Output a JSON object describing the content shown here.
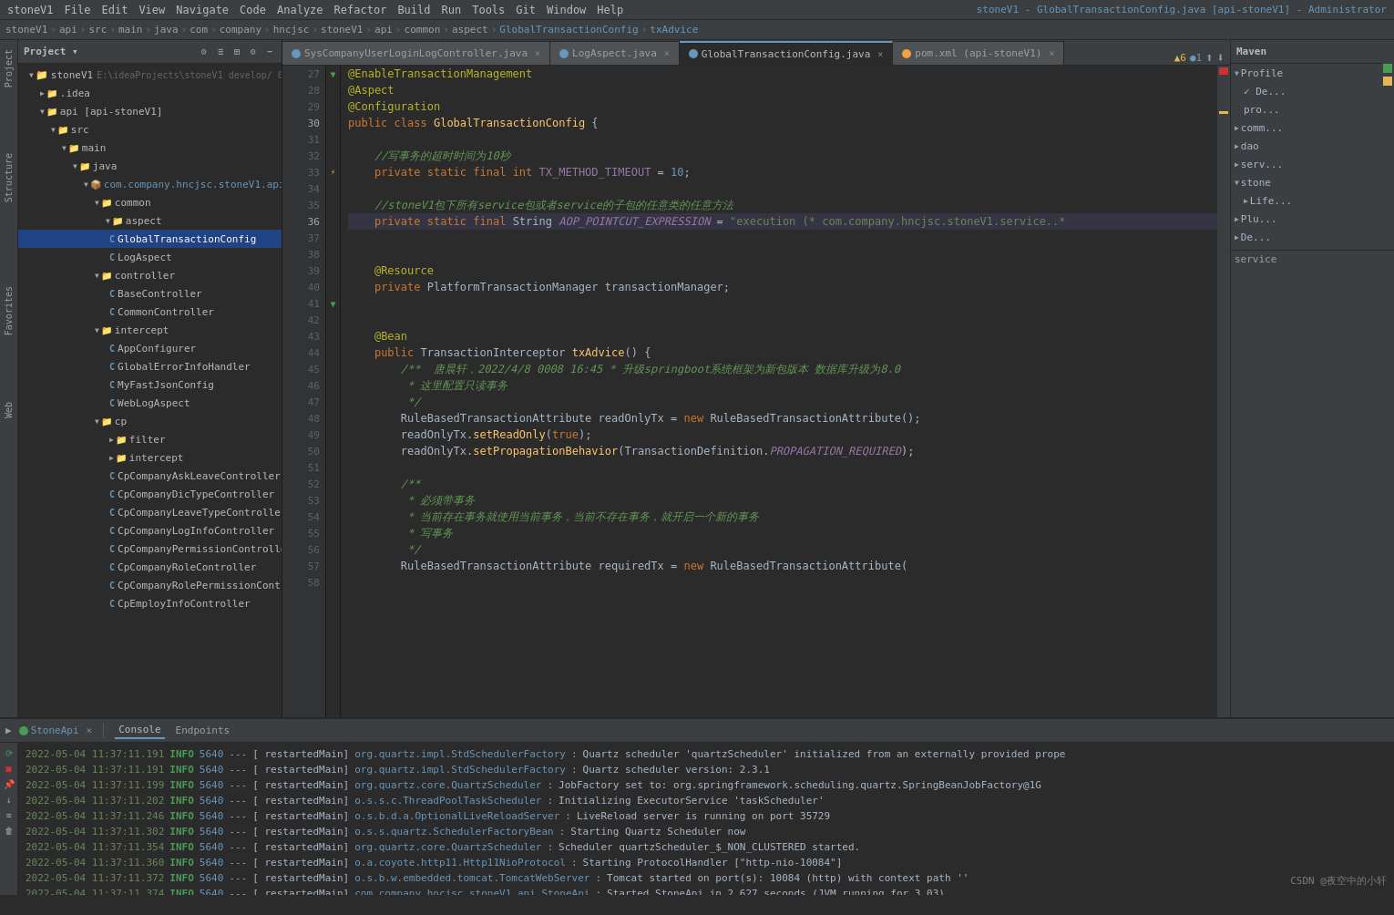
{
  "app": {
    "title": "stoneV1 - GlobalTransactionConfig.java [api-stoneV1] - Administrator"
  },
  "menubar": {
    "items": [
      "stoneV1",
      "File",
      "Edit",
      "View",
      "Navigate",
      "Code",
      "Analyze",
      "Refactor",
      "Build",
      "Run",
      "Tools",
      "Git",
      "Window",
      "Help"
    ]
  },
  "breadcrumb": {
    "items": [
      "stoneV1",
      "api",
      "src",
      "main",
      "java",
      "com",
      "company",
      "hncjsc",
      "stoneV1",
      "api",
      "common",
      "aspect",
      "GlobalTransactionConfig",
      "txAdvice"
    ]
  },
  "project_panel": {
    "header": "Project",
    "tree": [
      {
        "label": "stoneV1",
        "indent": 0,
        "type": "project",
        "expanded": true,
        "path": "E:\\ideaProjects\\stoneV1 develop/ 0"
      },
      {
        "label": ".idea",
        "indent": 1,
        "type": "folder",
        "expanded": false
      },
      {
        "label": "api [api-stoneV1]",
        "indent": 1,
        "type": "module",
        "expanded": true
      },
      {
        "label": "src",
        "indent": 2,
        "type": "folder",
        "expanded": true
      },
      {
        "label": "main",
        "indent": 3,
        "type": "folder",
        "expanded": true
      },
      {
        "label": "java",
        "indent": 4,
        "type": "folder",
        "expanded": true
      },
      {
        "label": "com.company.hncjsc.stoneV1.api",
        "indent": 5,
        "type": "package",
        "expanded": true
      },
      {
        "label": "common",
        "indent": 6,
        "type": "folder",
        "expanded": true
      },
      {
        "label": "aspect",
        "indent": 7,
        "type": "folder",
        "expanded": true
      },
      {
        "label": "GlobalTransactionConfig",
        "indent": 8,
        "type": "java",
        "selected": true
      },
      {
        "label": "LogAspect",
        "indent": 8,
        "type": "java"
      },
      {
        "label": "controller",
        "indent": 7,
        "type": "folder",
        "expanded": true
      },
      {
        "label": "BaseController",
        "indent": 8,
        "type": "java"
      },
      {
        "label": "CommonController",
        "indent": 8,
        "type": "java"
      },
      {
        "label": "intercept",
        "indent": 7,
        "type": "folder",
        "expanded": true
      },
      {
        "label": "AppConfigurer",
        "indent": 8,
        "type": "java"
      },
      {
        "label": "GlobalErrorInfoHandler",
        "indent": 8,
        "type": "java"
      },
      {
        "label": "MyFastJsonConfig",
        "indent": 8,
        "type": "java"
      },
      {
        "label": "WebLogAspect",
        "indent": 8,
        "type": "java"
      },
      {
        "label": "cp",
        "indent": 7,
        "type": "folder",
        "expanded": true
      },
      {
        "label": "filter",
        "indent": 8,
        "type": "folder"
      },
      {
        "label": "intercept",
        "indent": 8,
        "type": "folder"
      },
      {
        "label": "CpCompanyAskLeaveController",
        "indent": 8,
        "type": "java"
      },
      {
        "label": "CpCompanyDicTypeController",
        "indent": 8,
        "type": "java"
      },
      {
        "label": "CpCompanyLeaveTypeController",
        "indent": 8,
        "type": "java"
      },
      {
        "label": "CpCompanyLogInfoController",
        "indent": 8,
        "type": "java"
      },
      {
        "label": "CpCompanyPermissionController",
        "indent": 8,
        "type": "java"
      },
      {
        "label": "CpCompanyRoleController",
        "indent": 8,
        "type": "java"
      },
      {
        "label": "CpCompanyRolePermissionController",
        "indent": 8,
        "type": "java"
      },
      {
        "label": "CpEmployInfoController",
        "indent": 8,
        "type": "java"
      }
    ]
  },
  "tabs": [
    {
      "label": "SysCompanyUserLoginLogController.java",
      "type": "java",
      "active": false
    },
    {
      "label": "LogAspect.java",
      "type": "java",
      "active": false
    },
    {
      "label": "GlobalTransactionConfig.java",
      "type": "java",
      "active": true
    },
    {
      "label": "pom.xml (api-stoneV1)",
      "type": "xml",
      "active": false
    }
  ],
  "code": {
    "lines": [
      {
        "num": 27,
        "content": "@EnableTransactionManagement"
      },
      {
        "num": 28,
        "content": "@Aspect"
      },
      {
        "num": 29,
        "content": "@Configuration"
      },
      {
        "num": 30,
        "content": "public class GlobalTransactionConfig {"
      },
      {
        "num": 31,
        "content": ""
      },
      {
        "num": 32,
        "content": "    //写事务的超时时间为10秒"
      },
      {
        "num": 33,
        "content": "    private static final int TX_METHOD_TIMEOUT = 10;"
      },
      {
        "num": 34,
        "content": ""
      },
      {
        "num": 35,
        "content": "    //stoneV1包下所有service包或者service的子包的任意类的任意方法"
      },
      {
        "num": 36,
        "content": "    private static final String AOP_POINTCUT_EXPRESSION = \"execution (* com.company.hncjsc.stoneV1.service..*"
      },
      {
        "num": 37,
        "content": ""
      },
      {
        "num": 38,
        "content": ""
      },
      {
        "num": 39,
        "content": "    @Resource"
      },
      {
        "num": 40,
        "content": "    private PlatformTransactionManager transactionManager;"
      },
      {
        "num": 41,
        "content": ""
      },
      {
        "num": 42,
        "content": ""
      },
      {
        "num": 43,
        "content": "    @Bean"
      },
      {
        "num": 44,
        "content": "    public TransactionInterceptor txAdvice() {"
      },
      {
        "num": 45,
        "content": "        /**  唐晨轩，2022/4/8 0008 16:45 * 升级springboot系统框架为新包版本 数据库升级为8.0"
      },
      {
        "num": 46,
        "content": "         * 这里配置只读事务"
      },
      {
        "num": 47,
        "content": "         */"
      },
      {
        "num": 48,
        "content": "        RuleBasedTransactionAttribute readOnlyTx = new RuleBasedTransactionAttribute();"
      },
      {
        "num": 49,
        "content": "        readOnlyTx.setReadOnly(true);"
      },
      {
        "num": 50,
        "content": "        readOnlyTx.setPropagationBehavior(TransactionDefinition.PROPAGATION_REQUIRED);"
      },
      {
        "num": 51,
        "content": ""
      },
      {
        "num": 52,
        "content": "        /**"
      },
      {
        "num": 53,
        "content": "         * 必须带事务"
      },
      {
        "num": 54,
        "content": "         * 当前存在事务就使用当前事务，当前不存在事务，就开启一个新的事务"
      },
      {
        "num": 55,
        "content": "         * 写事务"
      },
      {
        "num": 56,
        "content": "         */"
      },
      {
        "num": 57,
        "content": "        RuleBasedTransactionAttribute requiredTx = new RuleBasedTransactionAttribute("
      }
    ]
  },
  "right_panel": {
    "header": "Maven",
    "items": [
      {
        "label": "Profile",
        "indent": 0,
        "arrow": "▶"
      },
      {
        "label": "De...",
        "indent": 1
      },
      {
        "label": "pro...",
        "indent": 1
      },
      {
        "label": "comm...",
        "indent": 0,
        "arrow": "▶"
      },
      {
        "label": "dao",
        "indent": 0,
        "arrow": "▶"
      },
      {
        "label": "serv...",
        "indent": 0,
        "arrow": "▶"
      },
      {
        "label": "stone",
        "indent": 0,
        "arrow": "▶"
      },
      {
        "label": "Life...",
        "indent": 1
      },
      {
        "label": "Plu...",
        "indent": 0
      },
      {
        "label": "De...",
        "indent": 0
      }
    ]
  },
  "run_panel": {
    "run_label": "StoneApi",
    "tabs": [
      "Console",
      "Endpoints"
    ],
    "logs": [
      {
        "time": "2022-05-04 11:37:11.191",
        "level": "INFO",
        "pid": "5640",
        "sep": "---",
        "thread": "[  restartedMain]",
        "class": "org.quartz.impl.StdSchedulerFactory",
        "msg": ": Quartz scheduler 'quartzScheduler' initialized from an externally provided prope"
      },
      {
        "time": "2022-05-04 11:37:11.191",
        "level": "INFO",
        "pid": "5640",
        "sep": "---",
        "thread": "[  restartedMain]",
        "class": "org.quartz.impl.StdSchedulerFactory",
        "msg": ": Quartz scheduler version: 2.3.1"
      },
      {
        "time": "2022-05-04 11:37:11.199",
        "level": "INFO",
        "pid": "5640",
        "sep": "---",
        "thread": "[  restartedMain]",
        "class": "org.quartz.core.QuartzScheduler",
        "msg": ": JobFactory set to: org.springframework.scheduling.quartz.SpringBeanJobFactory@1G"
      },
      {
        "time": "2022-05-04 11:37:11.202",
        "level": "INFO",
        "pid": "5640",
        "sep": "---",
        "thread": "[  restartedMain]",
        "class": "o.s.s.c.ThreadPoolTaskScheduler",
        "msg": ": Initializing ExecutorService 'taskScheduler'"
      },
      {
        "time": "2022-05-04 11:37:11.246",
        "level": "INFO",
        "pid": "5640",
        "sep": "---",
        "thread": "[  restartedMain]",
        "class": "o.s.b.d.a.OptionalLiveReloadServer",
        "msg": ": LiveReload server is running on port 35729"
      },
      {
        "time": "2022-05-04 11:37:11.302",
        "level": "INFO",
        "pid": "5640",
        "sep": "---",
        "thread": "[  restartedMain]",
        "class": "o.s.s.quartz.SchedulerFactoryBean",
        "msg": ": Starting Quartz Scheduler now"
      },
      {
        "time": "2022-05-04 11:37:11.354",
        "level": "INFO",
        "pid": "5640",
        "sep": "---",
        "thread": "[  restartedMain]",
        "class": "org.quartz.core.QuartzScheduler",
        "msg": ": Scheduler quartzScheduler_$_NON_CLUSTERED started."
      },
      {
        "time": "2022-05-04 11:37:11.360",
        "level": "INFO",
        "pid": "5640",
        "sep": "---",
        "thread": "[  restartedMain]",
        "class": "o.a.coyote.http11.Http11NioProtocol",
        "msg": ": Starting ProtocolHandler [\"http-nio-10084\"]"
      },
      {
        "time": "2022-05-04 11:37:11.372",
        "level": "INFO",
        "pid": "5640",
        "sep": "---",
        "thread": "[  restartedMain]",
        "class": "o.s.b.w.embedded.tomcat.TomcatWebServer",
        "msg": ": Tomcat started on port(s): 10084 (http) with context path ''"
      },
      {
        "time": "2022-05-04 11:37:11.374",
        "level": "INFO",
        "pid": "5640",
        "sep": "---",
        "thread": "[  restartedMain]",
        "class": "com.company.hncjsc.stoneV1.api.StoneApi",
        "msg": ": Started StoneApi in 2.627 seconds (JVM running for 3.03)"
      }
    ]
  },
  "watermark": "CSDN @夜空中的小轩",
  "right_panel_label": "service"
}
